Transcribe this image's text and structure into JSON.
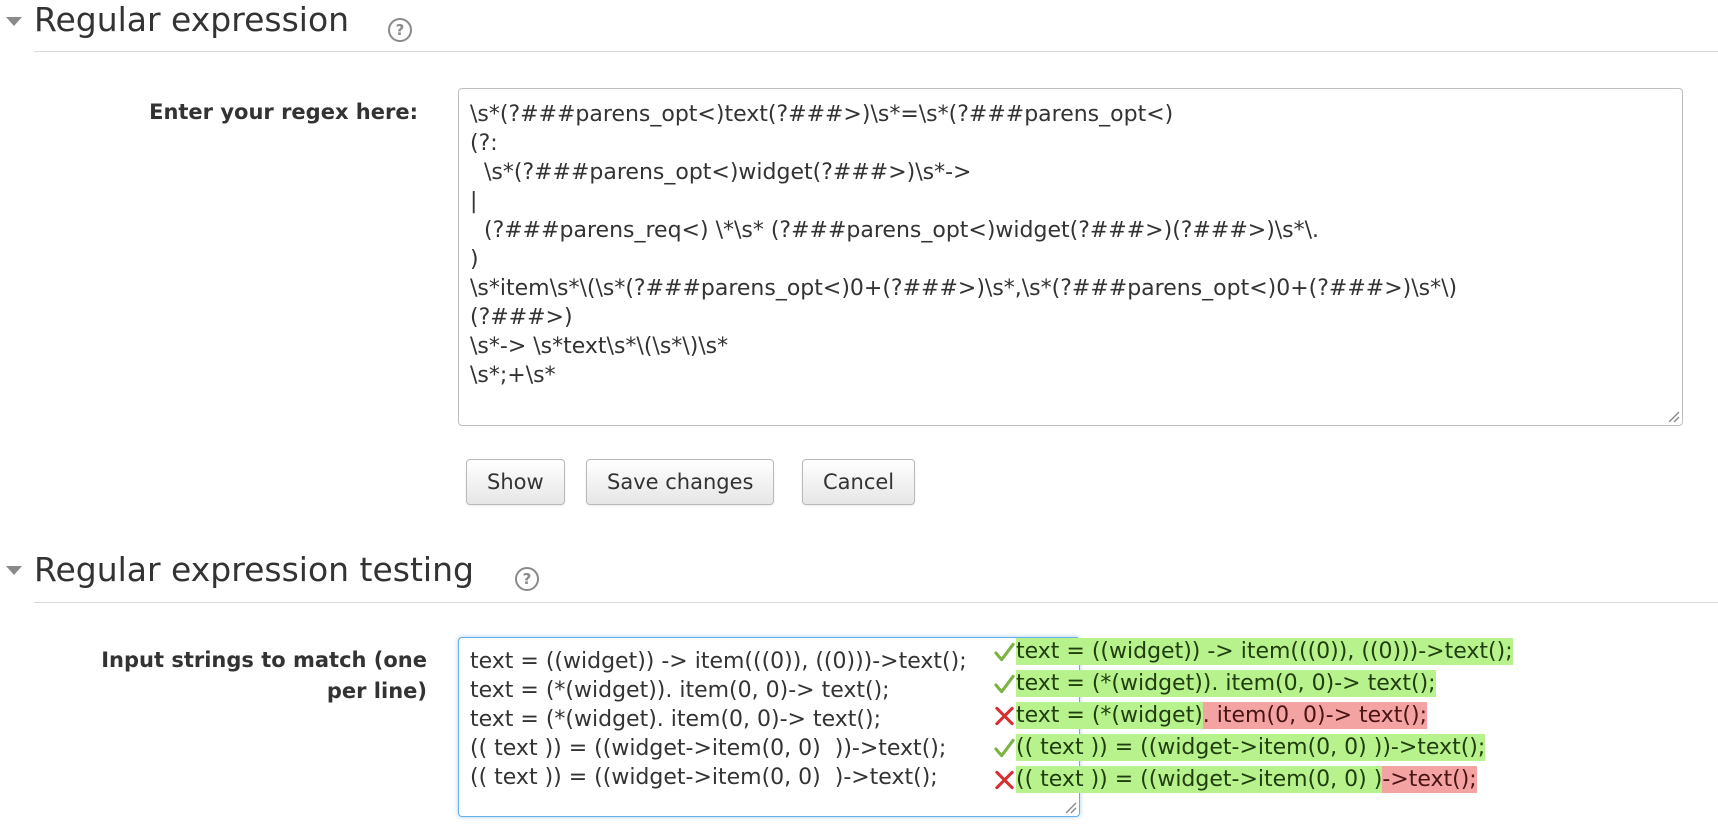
{
  "regex_section": {
    "title": "Regular expression",
    "help_icon": "?",
    "label": "Enter your regex here:",
    "lines": [
      "\\s*(?###parens_opt<)text(?###>)\\s*=\\s*(?###parens_opt<)",
      "(?:",
      "  \\s*(?###parens_opt<)widget(?###>)\\s*->",
      "|",
      "  (?###parens_req<) \\*\\s* (?###parens_opt<)widget(?###>)(?###>)\\s*\\.",
      ")",
      "\\s*item\\s*\\(\\s*(?###parens_opt<)0+(?###>)\\s*,\\s*(?###parens_opt<)0+(?###>)\\s*\\)",
      "(?###>)",
      "\\s*-> \\s*text\\s*\\(\\s*\\)\\s*",
      "\\s*;+\\s*"
    ]
  },
  "buttons": {
    "show": "Show",
    "save": "Save changes",
    "cancel": "Cancel"
  },
  "testing_section": {
    "title": "Regular expression testing",
    "help_icon": "?",
    "label_line1": "Input strings to match (one",
    "label_line2": "per line)",
    "input_lines": [
      "text = ((widget)) -> item(((0)), ((0)))->text();",
      "text = (*(widget)). item(0, 0)-> text();",
      "text = (*(widget). item(0, 0)-> text();",
      "(( text )) = ((widget->item(0, 0)  ))->text();",
      "(( text )) = ((widget->item(0, 0)  )->text();"
    ]
  },
  "results": [
    {
      "status": "match",
      "icon": "check-icon",
      "matched": "text = ((widget)) -> item(((0)), ((0)))->text();",
      "unmatched": ""
    },
    {
      "status": "match",
      "icon": "check-icon",
      "matched": "text = (*(widget)). item(0, 0)-> text();",
      "unmatched": ""
    },
    {
      "status": "no-match",
      "icon": "cross-icon",
      "matched": "text = (*(widget)",
      "unmatched": ". item(0, 0)-> text();"
    },
    {
      "status": "match",
      "icon": "check-icon",
      "matched": "(( text )) = ((widget->item(0, 0) ))->text();",
      "unmatched": ""
    },
    {
      "status": "no-match",
      "icon": "cross-icon",
      "matched": "(( text )) = ((widget->item(0, 0) )",
      "unmatched": "->text();"
    }
  ],
  "colors": {
    "match_bg": "#b8f28c",
    "nomatch_bg": "#f4a3a3",
    "check": "#7cb342",
    "cross": "#d32f2f",
    "focus_border": "#66afe9"
  }
}
